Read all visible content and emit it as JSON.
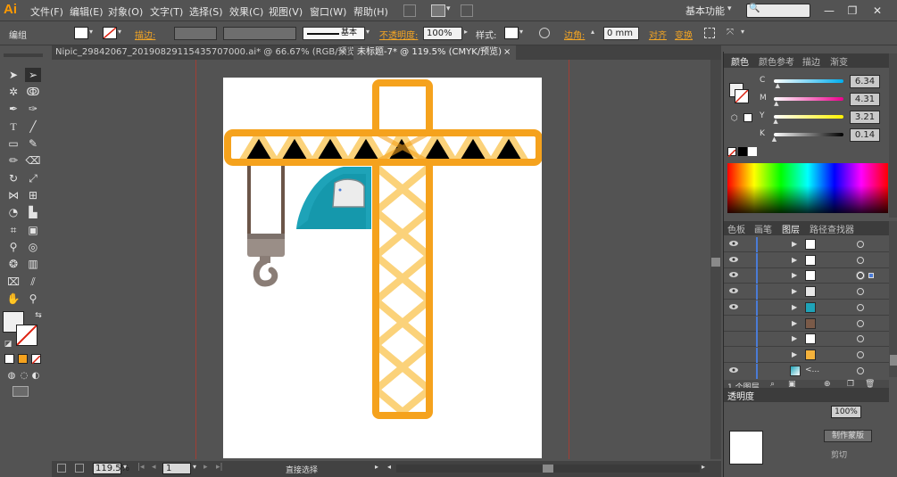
{
  "app": {
    "logo": "Ai",
    "menu": [
      "文件(F)",
      "编辑(E)",
      "对象(O)",
      "文字(T)",
      "选择(S)",
      "效果(C)",
      "视图(V)",
      "窗口(W)",
      "帮助(H)"
    ],
    "workspace": "基本功能",
    "workspace_arrow": "▾",
    "search_icon": "🔍"
  },
  "control_bar": {
    "selection_label": "编组",
    "stroke_label": "描边:",
    "stroke_style": "基本",
    "opacity_label": "不透明度:",
    "opacity_value": "100%",
    "style_label": "样式:",
    "corner_label": "边角:",
    "corner_value": "0 mm",
    "align_label": "对齐",
    "transform_label": "变换"
  },
  "tabs": [
    {
      "label": "Nipic_29842067_20190829115435707000.ai* @ 66.67% (RGB/预览)",
      "close": "×"
    },
    {
      "label": "未标题-7* @ 119.5% (CMYK/预览)",
      "close": "×"
    }
  ],
  "status_bar": {
    "zoom": "119.5%",
    "artboard_number": "1",
    "tool_name": "直接选择"
  },
  "color_panel": {
    "tabs": [
      "颜色",
      "颜色参考",
      "描边",
      "渐变"
    ],
    "channels": [
      {
        "label": "C",
        "value": "6.34",
        "pct": 0.06
      },
      {
        "label": "M",
        "value": "4.31",
        "pct": 0.04
      },
      {
        "label": "Y",
        "value": "3.21",
        "pct": 0.03
      },
      {
        "label": "K",
        "value": "0.14",
        "pct": 0.01
      }
    ]
  },
  "layers_panel": {
    "tabs": [
      "色板",
      "画笔",
      "图层",
      "路径查找器"
    ],
    "rows": [
      {
        "thumb_color": "#ffffff",
        "visible": true,
        "targeted": false
      },
      {
        "thumb_color": "#ffffff",
        "visible": true,
        "targeted": false
      },
      {
        "thumb_color": "#ffffff",
        "visible": true,
        "targeted": true
      },
      {
        "thumb_color": "#e8e8e8",
        "visible": true,
        "targeted": false
      },
      {
        "thumb_color": "#1ea3b8",
        "visible": true,
        "targeted": false
      },
      {
        "thumb_color": "#7a5a48",
        "visible": false,
        "targeted": false
      },
      {
        "thumb_color": "#ffffff",
        "visible": false,
        "targeted": false
      },
      {
        "thumb_color": "#f5b23b",
        "visible": false,
        "targeted": false
      }
    ],
    "sublayer_label": "<...",
    "count_label": "1 个图层"
  },
  "transparency_panel": {
    "tab": "透明度",
    "opacity_value": "100%",
    "mask_button": "制作蒙版",
    "clip_label": "剪切"
  },
  "colors": {
    "crane_orange": "#f5a21d",
    "crane_light": "#fbd27a",
    "cabin_teal": "#1ea3b8",
    "cable_brown": "#6b5548",
    "hook_grey": "#8a7d76",
    "guide_red": "#b53a2d",
    "accent_orange": "#f5a623"
  }
}
